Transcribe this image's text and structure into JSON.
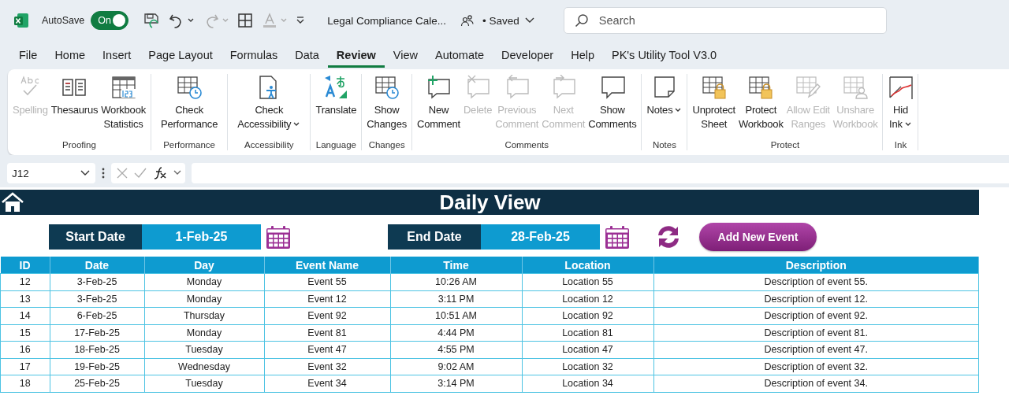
{
  "title_bar": {
    "autosave_label": "AutoSave",
    "autosave": {
      "label": "On",
      "on": true
    },
    "document_title": "Legal Compliance Cale...",
    "save_status": "• Saved",
    "search": {
      "placeholder": "Search"
    }
  },
  "menu_tabs": [
    {
      "label": "File",
      "selected": false
    },
    {
      "label": "Home",
      "selected": false
    },
    {
      "label": "Insert",
      "selected": false
    },
    {
      "label": "Page Layout",
      "selected": false
    },
    {
      "label": "Formulas",
      "selected": false
    },
    {
      "label": "Data",
      "selected": false
    },
    {
      "label": "Review",
      "selected": true
    },
    {
      "label": "View",
      "selected": false
    },
    {
      "label": "Automate",
      "selected": false
    },
    {
      "label": "Developer",
      "selected": false
    },
    {
      "label": "Help",
      "selected": false
    },
    {
      "label": "PK's Utility Tool V3.0",
      "selected": false
    }
  ],
  "ribbon_groups": [
    {
      "label": "Proofing",
      "buttons": [
        {
          "label": "Spelling",
          "disabled": true
        },
        {
          "label": "Thesaurus",
          "disabled": false
        },
        {
          "label": "Workbook\nStatistics",
          "disabled": false
        }
      ]
    },
    {
      "label": "Performance",
      "buttons": [
        {
          "label": "Check\nPerformance",
          "disabled": false
        }
      ]
    },
    {
      "label": "Accessibility",
      "buttons": [
        {
          "label": "Check\nAccessibility",
          "disabled": false,
          "dropdown": true
        }
      ]
    },
    {
      "label": "Language",
      "buttons": [
        {
          "label": "Translate",
          "disabled": false
        }
      ]
    },
    {
      "label": "Changes",
      "buttons": [
        {
          "label": "Show\nChanges",
          "disabled": false
        }
      ]
    },
    {
      "label": "Comments",
      "buttons": [
        {
          "label": "New\nComment",
          "disabled": false
        },
        {
          "label": "Delete",
          "disabled": true
        },
        {
          "label": "Previous\nComment",
          "disabled": true
        },
        {
          "label": "Next\nComment",
          "disabled": true
        },
        {
          "label": "Show\nComments",
          "disabled": false
        }
      ]
    },
    {
      "label": "Notes",
      "buttons": [
        {
          "label": "Notes",
          "disabled": false,
          "dropdown": true
        }
      ]
    },
    {
      "label": "Protect",
      "buttons": [
        {
          "label": "Unprotect\nSheet",
          "disabled": false
        },
        {
          "label": "Protect\nWorkbook",
          "disabled": false
        },
        {
          "label": "Allow Edit\nRanges",
          "disabled": true
        },
        {
          "label": "Unshare\nWorkbook",
          "disabled": true
        }
      ]
    },
    {
      "label": "Ink",
      "buttons": [
        {
          "label": "Hid\nInk",
          "disabled": false,
          "dropdown": true
        }
      ]
    }
  ],
  "formula_bar": {
    "name_box": "J12"
  },
  "sheet": {
    "title": "Daily View",
    "start_date": {
      "label": "Start Date",
      "value": "1-Feb-25"
    },
    "end_date": {
      "label": "End Date",
      "value": "28-Feb-25"
    },
    "add_button": "Add New Event",
    "table": {
      "columns": [
        "ID",
        "Date",
        "Day",
        "Event Name",
        "Time",
        "Location",
        "Description"
      ],
      "rows": [
        [
          "12",
          "3-Feb-25",
          "Monday",
          "Event 55",
          "10:26 AM",
          "Location 55",
          "Description of event 55."
        ],
        [
          "13",
          "3-Feb-25",
          "Monday",
          "Event 12",
          "3:11 PM",
          "Location 12",
          "Description of event 12."
        ],
        [
          "14",
          "6-Feb-25",
          "Thursday",
          "Event 92",
          "10:51 AM",
          "Location 92",
          "Description of event 92."
        ],
        [
          "15",
          "17-Feb-25",
          "Monday",
          "Event 81",
          "4:44 PM",
          "Location 81",
          "Description of event 81."
        ],
        [
          "16",
          "18-Feb-25",
          "Tuesday",
          "Event 47",
          "4:55 PM",
          "Location 47",
          "Description of event 47."
        ],
        [
          "17",
          "19-Feb-25",
          "Wednesday",
          "Event 32",
          "9:02 AM",
          "Location 32",
          "Description of event 32."
        ],
        [
          "18",
          "25-Feb-25",
          "Tuesday",
          "Event 34",
          "3:14 PM",
          "Location 34",
          "Description of event 34."
        ]
      ]
    }
  }
}
